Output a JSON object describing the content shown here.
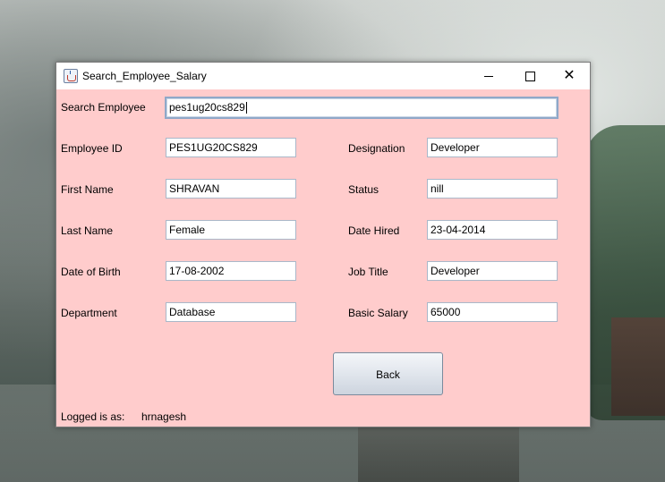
{
  "window": {
    "title": "Search_Employee_Salary",
    "controls": {
      "minimize": "minimize",
      "maximize": "maximize",
      "close": "✕"
    }
  },
  "search": {
    "label": "Search Employee",
    "value": "pes1ug20cs829"
  },
  "left_fields": [
    {
      "label": "Employee ID",
      "value": "PES1UG20CS829"
    },
    {
      "label": "First Name",
      "value": "SHRAVAN"
    },
    {
      "label": "Last Name",
      "value": "Female"
    },
    {
      "label": "Date of Birth",
      "value": "17-08-2002"
    },
    {
      "label": "Department",
      "value": "Database"
    }
  ],
  "right_fields": [
    {
      "label": "Designation",
      "value": "Developer"
    },
    {
      "label": "Status",
      "value": "nill"
    },
    {
      "label": "Date Hired",
      "value": "23-04-2014"
    },
    {
      "label": "Job Title",
      "value": "Developer"
    },
    {
      "label": "Basic Salary",
      "value": "65000"
    }
  ],
  "back_button": {
    "label": "Back"
  },
  "footer": {
    "logged_label": "Logged is as:",
    "username": "hrnagesh"
  },
  "colors": {
    "form_background": "#ffcccc",
    "titlebar": "#ffffff"
  }
}
